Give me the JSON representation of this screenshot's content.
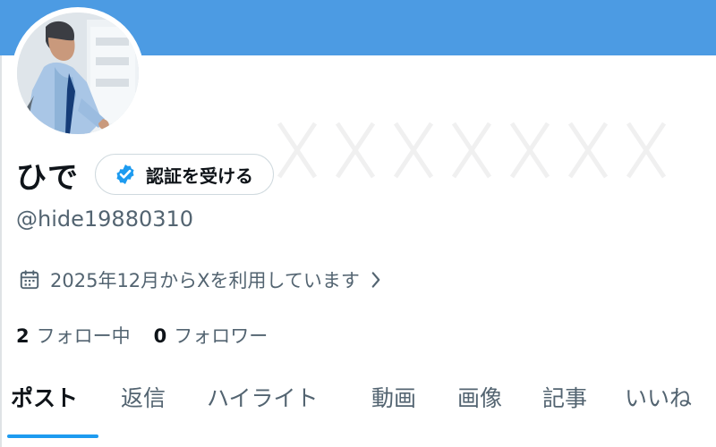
{
  "profile": {
    "display_name": "ひで",
    "handle": "@hide19880310",
    "verify_button_label": "認証を受ける",
    "joined_text": "2025年12月からXを利用しています",
    "following_count": "2",
    "following_label": "フォロー中",
    "followers_count": "0",
    "followers_label": "フォロワー"
  },
  "tabs": [
    {
      "label": "ポスト",
      "active": true
    },
    {
      "label": "返信",
      "active": false
    },
    {
      "label": "ハイライト",
      "active": false
    },
    {
      "label": "動画",
      "active": false
    },
    {
      "label": "画像",
      "active": false
    },
    {
      "label": "記事",
      "active": false
    },
    {
      "label": "いいね",
      "active": false
    }
  ],
  "icons": {
    "verify": "verified-badge-icon",
    "calendar": "calendar-icon",
    "chevron": "chevron-right-icon"
  },
  "colors": {
    "banner": "#4c9be3",
    "accent": "#1d9bf0",
    "text_primary": "#0f1419",
    "text_secondary": "#536471"
  }
}
